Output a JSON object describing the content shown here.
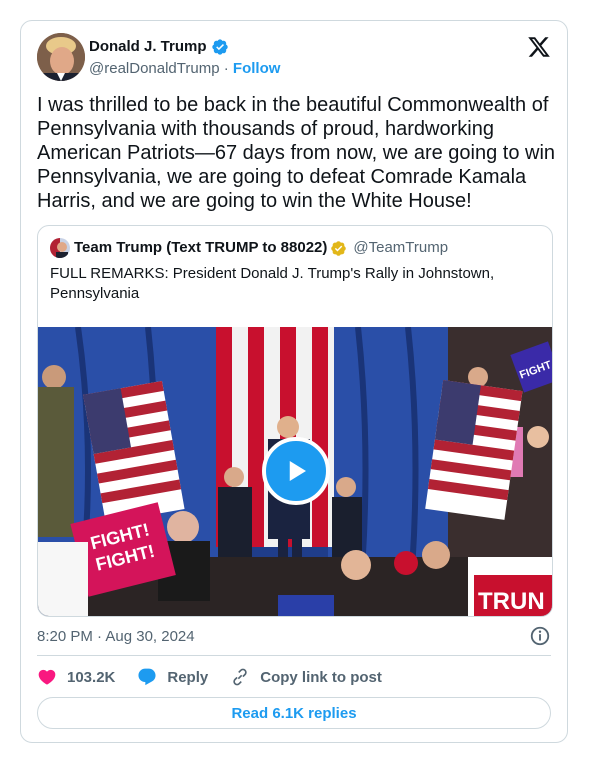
{
  "author": {
    "name": "Donald J. Trump",
    "handle": "@realDonaldTrump",
    "separator": "·",
    "follow_label": "Follow"
  },
  "tweet": {
    "text": "I was thrilled to be back in the beautiful Commonwealth of Pennsylvania with thousands of proud, hardworking American Patriots—67 days from now, we are going to win Pennsylvania, we are going to defeat Comrade Kamala Harris, and we are going to win the White House!"
  },
  "quote": {
    "name": "Team Trump (Text TRUMP to 88022)",
    "handle": "@TeamTrump",
    "text": "FULL REMARKS: President Donald J. Trump's Rally in Johnstown, Pennsylvania",
    "media": {
      "sign_left": "FIGHT! FIGHT!",
      "sign_right": "TRUMP",
      "sign_top_right": "FIGHT!"
    }
  },
  "meta": {
    "timestamp": "8:20 PM · Aug 30, 2024"
  },
  "actions": {
    "likes": "103.2K",
    "reply_label": "Reply",
    "copy_label": "Copy link to post",
    "read_replies_label": "Read 6.1K replies"
  },
  "colors": {
    "accent": "#1d9bf0",
    "like": "#f91880",
    "verified_gold": "#e2b719"
  },
  "icons": [
    "verified-badge-icon",
    "x-logo-icon",
    "play-icon",
    "info-icon",
    "heart-icon",
    "reply-bubble-icon",
    "link-icon"
  ]
}
